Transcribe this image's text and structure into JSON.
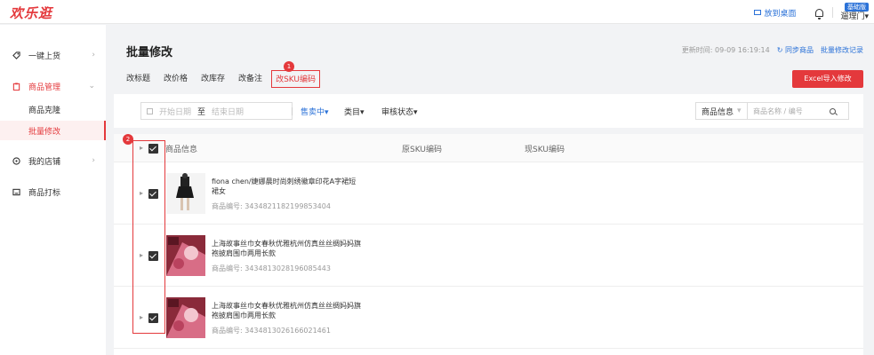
{
  "app": {
    "logo": "欢乐逛"
  },
  "topbar": {
    "desk_link": "放到桌面",
    "version_badge": "基础版",
    "store_name": "遛理门▾"
  },
  "sidebar": {
    "items": [
      {
        "label": "一键上货",
        "icon": "tag-icon"
      },
      {
        "label": "商品管理",
        "icon": "clipboard-icon",
        "active": true
      },
      {
        "label": "我的店铺",
        "icon": "store-icon"
      },
      {
        "label": "商品打标",
        "icon": "label-icon"
      }
    ],
    "sub_items": [
      {
        "label": "商品克隆"
      },
      {
        "label": "批量修改",
        "active": true
      }
    ]
  },
  "page": {
    "title": "批量修改",
    "update_time": "更新时间: 09-09 16:19:14",
    "sync_link": "同步商品",
    "history_link": "批量修改记录",
    "excel_button": "Excel导入修改"
  },
  "tabs": [
    "改标题",
    "改价格",
    "改库存",
    "改备注",
    "改SKU编码"
  ],
  "annotations": {
    "badge1": "1",
    "badge2": "2"
  },
  "filters": {
    "start_placeholder": "开始日期",
    "range_to": "至",
    "end_placeholder": "结束日期",
    "status": "售卖中▾",
    "category": "类目▾",
    "audit": "审核状态▾",
    "search_type": "商品信息",
    "search_caret": "▾",
    "search_placeholder": "商品名称 / 编号"
  },
  "table": {
    "headers": [
      "商品信息",
      "原SKU编码",
      "现SKU编码"
    ],
    "rows": [
      {
        "title": "fiona chen/婕娜晨时尚刺绣徽章印花A字裙短裙女",
        "product_no": "商品编号: 3434821182199853404"
      },
      {
        "title": "上海故事丝巾女春秋优雅杭州仿真丝丝绸妈妈旗袍披肩围巾两用长款",
        "product_no": "商品编号: 3434813028196085443"
      },
      {
        "title": "上海故事丝巾女春秋优雅杭州仿真丝丝绸妈妈旗袍披肩围巾两用长款",
        "product_no": "商品编号: 3434813026166021461"
      }
    ]
  },
  "colors": {
    "accent": "#e4393c",
    "link": "#2b72d8"
  }
}
